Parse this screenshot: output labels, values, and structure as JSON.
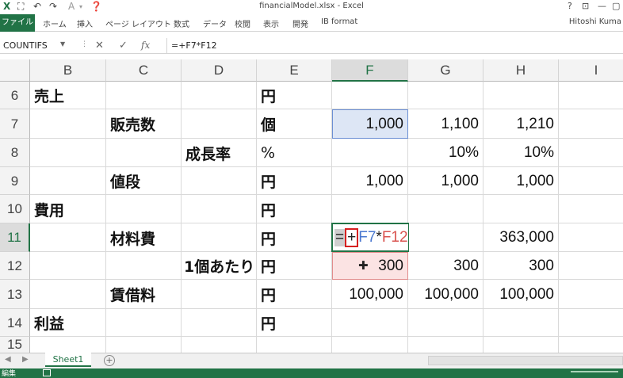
{
  "window": {
    "title": "financialModel.xlsx - Excel",
    "controls": [
      "?",
      "⊡",
      "—",
      "▢"
    ]
  },
  "quick_access": [
    "save-icon",
    "undo-icon",
    "redo-icon",
    "font-color-icon",
    "help-icon"
  ],
  "ribbon": {
    "file_tab": "ファイル",
    "tabs": [
      "ホーム",
      "挿入",
      "ページ レイアウト",
      "数式",
      "データ",
      "校閲",
      "表示",
      "開発",
      "IB format"
    ],
    "user": "Hitoshi Kuma"
  },
  "formula_bar": {
    "name_box": "COUNTIFS",
    "formula": "=+F7*F12"
  },
  "sheet": {
    "columns": [
      "B",
      "C",
      "D",
      "E",
      "F",
      "G",
      "H",
      "I"
    ],
    "active_column": "F",
    "rows": [
      "6",
      "7",
      "8",
      "9",
      "10",
      "11",
      "12",
      "13",
      "14",
      "15"
    ],
    "active_row": "11",
    "cells": {
      "B6": "売上",
      "E6": "円",
      "C7": "販売数",
      "E7": "個",
      "F7": "1,000",
      "G7": "1,100",
      "H7": "1,210",
      "D8": "成長率",
      "E8": "%",
      "G8": "10%",
      "H8": "10%",
      "C9": "値段",
      "E9": "円",
      "F9": "1,000",
      "G9": "1,000",
      "H9": "1,000",
      "B10": "費用",
      "E10": "円",
      "C11": "材料費",
      "E11": "円",
      "H11": "363,000",
      "D12": "1個あたり",
      "E12": "円",
      "F12": "300",
      "G12": "300",
      "H12": "300",
      "C13": "賃借料",
      "E13": "円",
      "F13": "100,000",
      "G13": "100,000",
      "H13": "100,000",
      "B14": "利益",
      "E14": "円"
    },
    "editing_formula": {
      "eq": "=",
      "plus": "+",
      "ref1": "F7",
      "op": "*",
      "ref2": "F12"
    }
  },
  "sheet_tabs": {
    "active": "Sheet1"
  },
  "status": {
    "mode": "編集"
  },
  "colors": {
    "excel_green": "#217346",
    "ref1_blue": "#4a78d0",
    "ref2_red": "#d9534f"
  }
}
